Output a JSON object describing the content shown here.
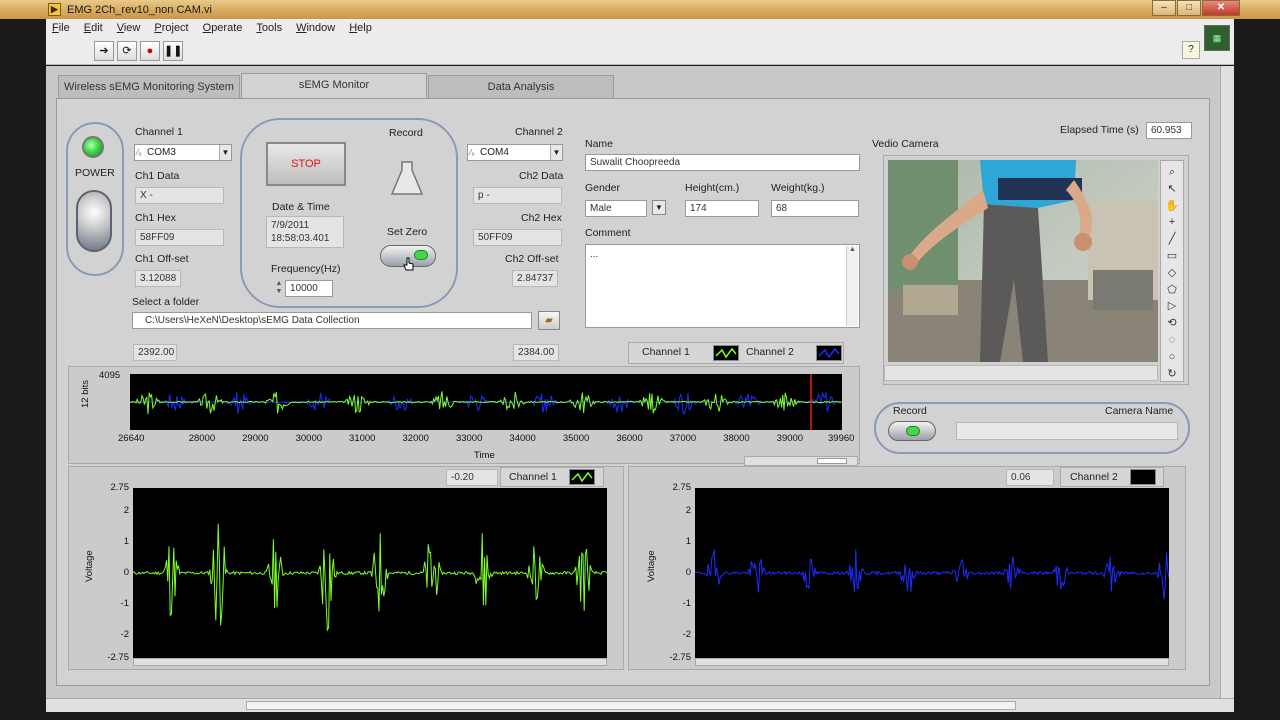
{
  "window": {
    "title": "EMG 2Ch_rev10_non CAM.vi"
  },
  "menu": [
    "File",
    "Edit",
    "View",
    "Project",
    "Operate",
    "Tools",
    "Window",
    "Help"
  ],
  "toolbar": {
    "run": "➔",
    "run_cont": "⟳",
    "abort": "●",
    "pause": "❚❚",
    "help": "?"
  },
  "tabs": [
    {
      "label": "Wireless sEMG Monitoring System"
    },
    {
      "label": "sEMG Monitor"
    },
    {
      "label": "Data Analysis"
    }
  ],
  "power": {
    "label": "POWER",
    "led_color": "#3fd94a"
  },
  "ch1": {
    "label": "Channel 1",
    "port": "COM3",
    "data_label": "Ch1 Data",
    "data": "X -",
    "hex_label": "Ch1 Hex",
    "hex": "58FF09",
    "offset_label": "Ch1 Off-set",
    "offset": "3.12088",
    "value": "2392.00"
  },
  "ch2": {
    "label": "Channel 2",
    "port": "COM4",
    "data_label": "Ch2 Data",
    "data": "p -",
    "hex_label": "Ch2 Hex",
    "hex": "50FF09",
    "offset_label": "Ch2 Off-set",
    "offset": "2.84737",
    "value": "2384.00"
  },
  "control": {
    "stop": "STOP",
    "record": "Record",
    "datetime_label": "Date & Time",
    "date": "7/9/2011",
    "time": "18:58:03.401",
    "setzero": "Set Zero",
    "freq_label": "Frequency(Hz)",
    "freq": "10000"
  },
  "folder": {
    "label": "Select a folder",
    "path": "C:\\Users\\HeXeN\\Desktop\\sEMG Data Collection"
  },
  "subject": {
    "name_label": "Name",
    "name": "Suwalit Choopreeda",
    "gender_label": "Gender",
    "gender": "Male",
    "height_label": "Height(cm.)",
    "height": "174",
    "weight_label": "Weight(kg.)",
    "weight": "68",
    "comment_label": "Comment",
    "comment": "..."
  },
  "legend": {
    "ch1": "Channel 1",
    "ch2": "Channel 2"
  },
  "camera": {
    "label": "Vedio Camera",
    "elapsed_label": "Elapsed Time (s)",
    "elapsed": "60.953",
    "record_label": "Record",
    "name_label": "Camera Name"
  },
  "colors": {
    "ch1": "#7dff2a",
    "ch2": "#1d2cff"
  },
  "chart_data": [
    {
      "type": "line",
      "ylabel": "12 bits",
      "xlabel": "Time",
      "xlim": [
        26640,
        39960
      ],
      "ylim_top_label": "4095",
      "xticks": [
        "26640",
        "28000",
        "29000",
        "30000",
        "31000",
        "32000",
        "33000",
        "34000",
        "35000",
        "36000",
        "37000",
        "38000",
        "39000",
        "39960"
      ],
      "series": [
        {
          "name": "Channel 1"
        },
        {
          "name": "Channel 2"
        }
      ],
      "bursts": [
        26980,
        27480,
        28140,
        28680,
        29400,
        30180,
        30900,
        31700,
        32500,
        33100,
        33800,
        34400,
        35100,
        35800,
        36400,
        37000,
        37600,
        38200,
        38900,
        39600
      ]
    },
    {
      "type": "line",
      "ylabel": "Voltage",
      "cursor_value": "-0.20",
      "legend": "Channel 1",
      "ylim": [
        -2.75,
        2.75
      ],
      "yticks": [
        "2.75",
        "2",
        "1",
        "0",
        "-1",
        "-2",
        "-2.75"
      ],
      "bursts": [
        0.08,
        0.18,
        0.3,
        0.41,
        0.52,
        0.63,
        0.74,
        0.85,
        0.95
      ],
      "amplitude": [
        1.6,
        2.4,
        1.4,
        2.4,
        1.6,
        1.6,
        1.8,
        1.2,
        1.5
      ]
    },
    {
      "type": "line",
      "ylabel": "Voltage",
      "cursor_value": "0.06",
      "legend": "Channel 2",
      "ylim": [
        -2.75,
        2.75
      ],
      "yticks": [
        "2.75",
        "2",
        "1",
        "0",
        "-1",
        "-2",
        "-2.75"
      ],
      "bursts": [
        0.04,
        0.13,
        0.24,
        0.34,
        0.45,
        0.56,
        0.67,
        0.77,
        0.88,
        0.99
      ],
      "amplitude": [
        0.8,
        0.9,
        0.7,
        0.8,
        0.9,
        0.8,
        0.7,
        0.7,
        0.8,
        0.9
      ]
    }
  ]
}
